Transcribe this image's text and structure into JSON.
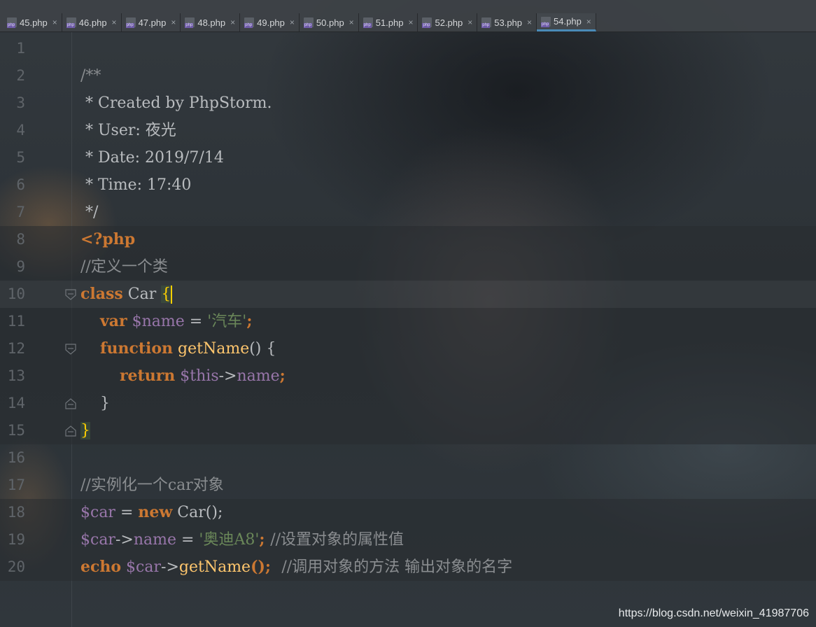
{
  "tabs": [
    {
      "label": "45.php",
      "active": false
    },
    {
      "label": "46.php",
      "active": false
    },
    {
      "label": "47.php",
      "active": false
    },
    {
      "label": "48.php",
      "active": false
    },
    {
      "label": "49.php",
      "active": false
    },
    {
      "label": "50.php",
      "active": false
    },
    {
      "label": "51.php",
      "active": false
    },
    {
      "label": "52.php",
      "active": false
    },
    {
      "label": "53.php",
      "active": false
    },
    {
      "label": "54.php",
      "active": true
    }
  ],
  "close_glyph": "×",
  "line_numbers": [
    "1",
    "2",
    "3",
    "4",
    "5",
    "6",
    "7",
    "8",
    "9",
    "10",
    "11",
    "12",
    "13",
    "14",
    "15",
    "16",
    "17",
    "18",
    "19",
    "20"
  ],
  "code": {
    "l2": "/**",
    "l3": " * Created by PhpStorm.",
    "l4": " * User: 夜光",
    "l5": " * Date: 2019/7/14",
    "l6": " * Time: 17:40",
    "l7": " */",
    "l8": "<?php",
    "l9": "//定义一个类",
    "l10_kw": "class",
    "l10_name": " Car ",
    "l10_brace": "{",
    "l11_indent": "    ",
    "l11_kw": "var",
    "l11_var": " $name",
    "l11_eq": " = ",
    "l11_str": "'汽车'",
    "l11_end": ";",
    "l12_indent": "    ",
    "l12_kw": "function",
    "l12_fn": " getName",
    "l12_rest": "() {",
    "l13_indent": "        ",
    "l13_kw": "return",
    "l13_var": " $this",
    "l13_arrow": "->",
    "l13_prop": "name",
    "l13_end": ";",
    "l14": "    }",
    "l15_brace": "}",
    "l17": "//实例化一个car对象",
    "l18_var": "$car",
    "l18_eq": " = ",
    "l18_kw": "new",
    "l18_rest": " Car();",
    "l19_var": "$car",
    "l19_arrow": "->",
    "l19_prop": "name",
    "l19_eq": " = ",
    "l19_str": "'奥迪A8'",
    "l19_end": "; ",
    "l19_cm": "//设置对象的属性值",
    "l20_kw": "echo",
    "l20_var": " $car",
    "l20_arrow": "->",
    "l20_fn": "getName",
    "l20_end": "();  ",
    "l20_cm": "//调用对象的方法 输出对象的名字"
  },
  "watermark": "https://blog.csdn.net/weixin_41987706",
  "colors": {
    "keyword": "#cc7832",
    "variable": "#9876aa",
    "string": "#6a8759",
    "comment": "#8a8d90",
    "function": "#ffc66d",
    "brace_match": "#ffd000",
    "active_tab_underline": "#4a8bb8"
  },
  "icons": {
    "tab_file": "php-file-icon",
    "tab_close": "close-icon",
    "fold": "fold-marker-icon"
  }
}
